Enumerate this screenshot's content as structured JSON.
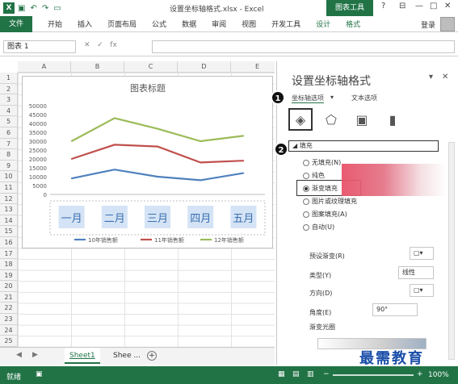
{
  "window": {
    "title": "设置坐标轴格式.xlsx - Excel",
    "context_tab": "图表工具",
    "controls": [
      "?",
      "⊟",
      "—",
      "□",
      "✕"
    ]
  },
  "ribbon": {
    "file": "文件",
    "tabs": [
      "开始",
      "插入",
      "页面布局",
      "公式",
      "数据",
      "审阅",
      "视图",
      "开发工具"
    ],
    "ctx_tabs": [
      "设计",
      "格式"
    ],
    "login": "登录"
  },
  "formula": {
    "namebox": "图表 1",
    "fx": "fx"
  },
  "columns": [
    "A",
    "B",
    "C",
    "D",
    "E"
  ],
  "rows": [
    "1",
    "2",
    "3",
    "4",
    "5",
    "6",
    "7",
    "8",
    "9",
    "10",
    "11",
    "12",
    "13",
    "14",
    "15",
    "16",
    "17",
    "18",
    "19",
    "20",
    "21",
    "22",
    "23",
    "24",
    "25"
  ],
  "chart_data": {
    "type": "line",
    "title": "图表标题",
    "categories": [
      "一月",
      "二月",
      "三月",
      "四月",
      "五月"
    ],
    "yticks": [
      "50000",
      "45000",
      "40000",
      "35000",
      "30000",
      "25000",
      "20000",
      "15000",
      "10000",
      "5000",
      "0"
    ],
    "ylim": [
      0,
      50000
    ],
    "series": [
      {
        "name": "10年销售额",
        "color": "#4f81bd",
        "values": [
          9000,
          14000,
          10000,
          8000,
          12000
        ]
      },
      {
        "name": "11年销售额",
        "color": "#c0504d",
        "values": [
          20000,
          28000,
          27000,
          18000,
          19000
        ]
      },
      {
        "name": "12年销售额",
        "color": "#9bbb59",
        "values": [
          30000,
          43000,
          37000,
          30000,
          33000
        ]
      }
    ],
    "legend": "bottom"
  },
  "sheets": {
    "active": "Sheet1",
    "other": "Shee ...",
    "add": "+"
  },
  "status": {
    "ready": "就绪",
    "zoom": "100%"
  },
  "pane": {
    "title": "设置坐标轴格式",
    "sub_tabs": [
      "坐标轴选项",
      "文本选项"
    ],
    "section": "填充",
    "options": [
      "无填充(N)",
      "纯色",
      "渐变填充",
      "图片或纹理填充",
      "图案填充(A)",
      "自动(U)"
    ],
    "selected_option": "渐变填充",
    "fields": {
      "preset": "预设渐变(R)",
      "type": "类型(Y)",
      "type_value": "线性",
      "direction": "方向(D)",
      "angle": "角度(E)",
      "angle_value": "90°",
      "stops": "渐变光圈"
    },
    "badges": [
      "1",
      "2"
    ]
  },
  "watermark": "最需教育"
}
